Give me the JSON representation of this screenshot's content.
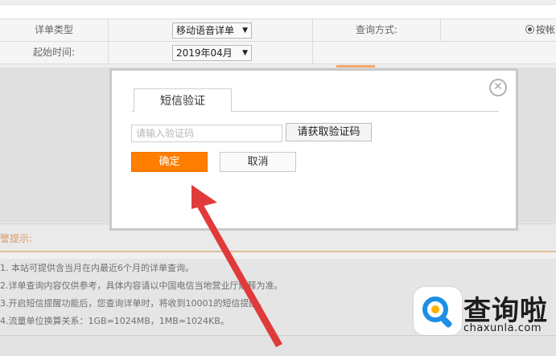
{
  "query_form": {
    "detail_type_label": "详单类型",
    "detail_type_value": "移动语音详单",
    "query_method_label": "查询方式:",
    "query_method_radio_label": "按帐",
    "start_time_label": "起始时间:",
    "start_time_value": "2019年04月"
  },
  "dialog": {
    "tab_label": "短信验证",
    "code_placeholder": "请输入验证码",
    "get_code_label": "请获取验证码",
    "confirm_label": "确定",
    "cancel_label": "取消",
    "close_icon": "close-icon"
  },
  "notice": {
    "title": "警提示:",
    "items": [
      "1. 本站可提供含当月在内最近6个月的详单查询。",
      "2.详单查询内容仅供参考，具体内容请以中国电信当地营业厅解释为准。",
      "3.开启短信提醒功能后，您查询详单时，将收到10001的短信提醒。",
      "4.流量单位换算关系：1GB=1024MB，1MB=1024KB。"
    ]
  },
  "watermark": {
    "name": "查询啦",
    "url": "chaxunla.com"
  },
  "colors": {
    "accent_orange": "#ff7e00",
    "arrow_red": "#e03a3a",
    "watermark_blue": "#1e8fe6"
  }
}
